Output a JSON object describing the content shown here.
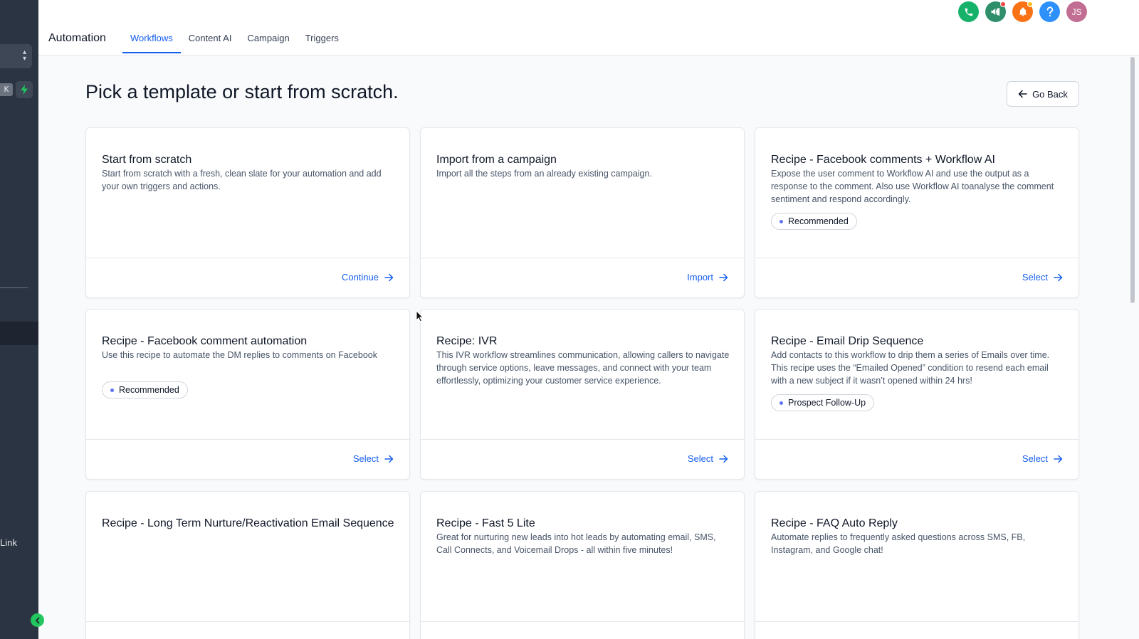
{
  "sidebar": {
    "shortcut_key": "K",
    "link_label": "Link"
  },
  "header": {
    "title": "Automation",
    "tabs": [
      {
        "label": "Workflows",
        "active": true
      },
      {
        "label": "Content AI",
        "active": false
      },
      {
        "label": "Campaign",
        "active": false
      },
      {
        "label": "Triggers",
        "active": false
      }
    ],
    "user_initials": "JS",
    "icon_colors": {
      "phone": "#17b26a",
      "announcement": "#2f8f6b",
      "notifications": "#f97316",
      "help": "#2e90fa",
      "avatar": "#c26d92"
    }
  },
  "main": {
    "title": "Pick a template or start from scratch.",
    "go_back_label": "Go Back",
    "cards": [
      {
        "title": "Start from scratch",
        "description": "Start from scratch with a fresh, clean slate for your automation and add your own triggers and actions.",
        "badge": "",
        "action": "Continue"
      },
      {
        "title": "Import from a campaign",
        "description": "Import all the steps from an already existing campaign.",
        "badge": "",
        "action": "Import"
      },
      {
        "title": "Recipe - Facebook comments + Workflow AI",
        "description": "Expose the user comment to Workflow AI and use the output as a response to the comment. Also use Workflow AI toanalyse the comment sentiment and respond accordingly.",
        "badge": "Recommended",
        "action": "Select"
      },
      {
        "title": "Recipe - Facebook comment automation",
        "description": "Use this recipe to automate the DM replies to comments on Facebook",
        "badge": "Recommended",
        "action": "Select"
      },
      {
        "title": "Recipe: IVR",
        "description": "This IVR workflow streamlines communication, allowing callers to navigate through service options, leave messages, and connect with your team effortlessly, optimizing your customer service experience.",
        "badge": "",
        "action": "Select"
      },
      {
        "title": "Recipe - Email Drip Sequence",
        "description": "Add contacts to this workflow to drip them a series of Emails over time. This recipe uses the “Emailed Opened” condition to resend each email with a new subject if it wasn’t opened within 24 hrs!",
        "badge": "Prospect Follow-Up",
        "action": "Select"
      },
      {
        "title": "Recipe - Long Term Nurture/Reactivation Email Sequence",
        "description": "",
        "badge": "",
        "action": ""
      },
      {
        "title": "Recipe - Fast 5 Lite",
        "description": "Great for nurturing new leads into hot leads by automating email, SMS, Call Connects, and Voicemail Drops - all within five minutes!",
        "badge": "",
        "action": ""
      },
      {
        "title": "Recipe - FAQ Auto Reply",
        "description": "Automate replies to frequently asked questions across SMS, FB, Instagram, and Google chat!",
        "badge": "",
        "action": ""
      }
    ]
  },
  "colors": {
    "accent": "#155eef",
    "badge_dot": "#6172f3",
    "sidebar_bg": "#2b3442"
  }
}
